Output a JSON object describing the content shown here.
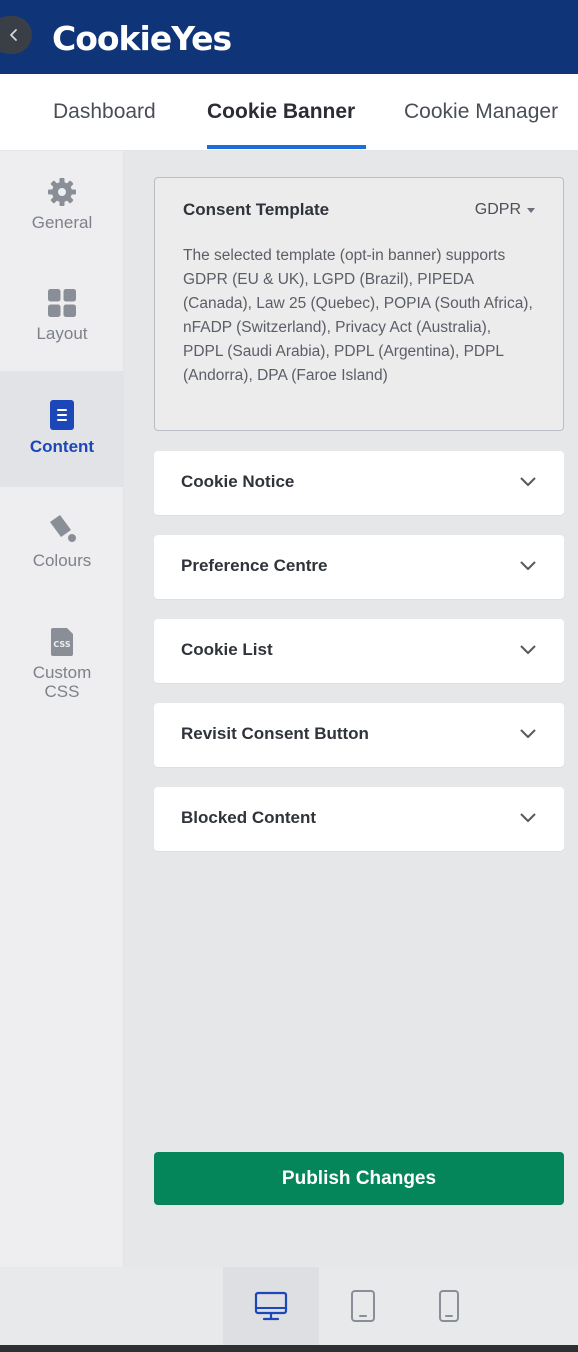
{
  "header": {
    "logo": "CookieYes"
  },
  "tabs": [
    {
      "label": "Dashboard",
      "active": false
    },
    {
      "label": "Cookie Banner",
      "active": true
    },
    {
      "label": "Cookie Manager",
      "active": false
    }
  ],
  "sidebar": {
    "items": [
      {
        "label": "General",
        "icon": "gear-icon",
        "active": false
      },
      {
        "label": "Layout",
        "icon": "layout-grid-icon",
        "active": false
      },
      {
        "label": "Content",
        "icon": "document-icon",
        "active": true
      },
      {
        "label": "Colours",
        "icon": "paint-bucket-icon",
        "active": false
      },
      {
        "label": "Custom CSS",
        "icon": "css-file-icon",
        "active": false
      }
    ]
  },
  "template": {
    "title": "Consent Template",
    "selected": "GDPR",
    "description": "The selected template (opt-in banner) supports GDPR (EU & UK), LGPD (Brazil), PIPEDA (Canada), Law 25 (Quebec), POPIA (South Africa), nFADP (Switzerland), Privacy Act (Australia), PDPL (Saudi Arabia), PDPL (Argentina), PDPL (Andorra), DPA (Faroe Island)"
  },
  "sections": [
    {
      "label": "Cookie Notice"
    },
    {
      "label": "Preference Centre"
    },
    {
      "label": "Cookie List"
    },
    {
      "label": "Revisit Consent Button"
    },
    {
      "label": "Blocked Content"
    }
  ],
  "publish": {
    "label": "Publish Changes"
  },
  "devices": [
    {
      "icon": "desktop-icon",
      "active": true
    },
    {
      "icon": "tablet-icon",
      "active": false
    },
    {
      "icon": "mobile-icon",
      "active": false
    }
  ],
  "colors": {
    "header_bg": "#0f3578",
    "accent": "#1a6fd8",
    "active_sidebar": "#1c47b8",
    "publish_bg": "#05855a"
  }
}
